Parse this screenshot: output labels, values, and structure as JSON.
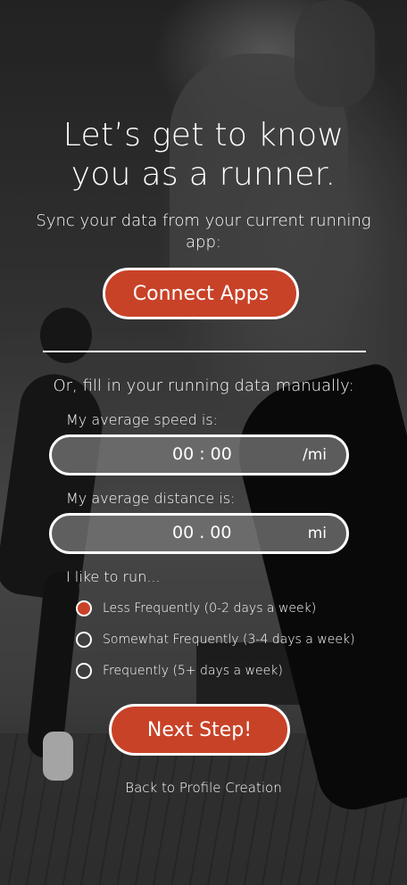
{
  "header": {
    "title_line1": "Let’s get to know",
    "title_line2": "you as a runner.",
    "subtitle": "Sync your data from your current running app:"
  },
  "connect": {
    "label": "Connect Apps"
  },
  "manual": {
    "heading": "Or, fill in your running data manually:",
    "speed": {
      "label": "My average speed is:",
      "value": "00 : 00",
      "unit": "/mi"
    },
    "distance": {
      "label": "My average distance is:",
      "value": "00 . 00",
      "unit": "mi"
    },
    "frequency": {
      "label": "I like to run...",
      "selected_index": 0,
      "options": [
        "Less Frequently (0-2 days a week)",
        "Somewhat Frequently (3-4 days a week)",
        "Frequently (5+ days a week)"
      ]
    }
  },
  "actions": {
    "next_label": "Next Step!",
    "back_label": "Back to Profile Creation"
  },
  "colors": {
    "accent": "#c84228",
    "text": "#ffffff"
  }
}
